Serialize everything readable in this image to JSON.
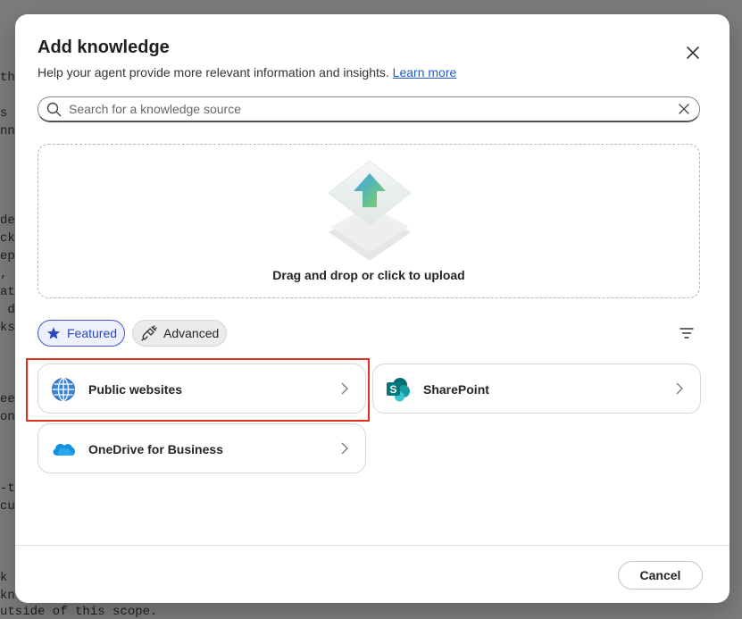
{
  "background_text": [
    {
      "id": "bg1",
      "text": "th"
    },
    {
      "id": "bg2",
      "text": "s"
    },
    {
      "id": "bg3",
      "text": "nn"
    },
    {
      "id": "bg4",
      "text": "de"
    },
    {
      "id": "bg5",
      "text": "ck"
    },
    {
      "id": "bg6",
      "text": "ep"
    },
    {
      "id": "bg7",
      "text": ","
    },
    {
      "id": "bg8",
      "text": "at"
    },
    {
      "id": "bg9",
      "text": " d"
    },
    {
      "id": "bg10",
      "text": "ks"
    },
    {
      "id": "bg11",
      "text": "ee"
    },
    {
      "id": "bg12",
      "text": "on"
    },
    {
      "id": "bg13",
      "text": "-t"
    },
    {
      "id": "bg14",
      "text": "cu"
    },
    {
      "id": "bg15",
      "text": "k"
    },
    {
      "id": "bg16",
      "text": "kn"
    },
    {
      "id": "bg17",
      "text": "utside of this scope."
    }
  ],
  "dialog": {
    "title": "Add knowledge",
    "subtitle": "Help your agent provide more relevant information and insights.",
    "learn_more": "Learn more",
    "close_icon": "close-icon"
  },
  "search": {
    "placeholder": "Search for a knowledge source",
    "value": ""
  },
  "dropzone": {
    "label": "Drag and drop or click to upload",
    "icon": "upload-icon"
  },
  "filters": {
    "featured": "Featured",
    "advanced": "Advanced",
    "active": "Featured"
  },
  "sources": [
    {
      "label": "Public websites",
      "icon": "globe-icon"
    },
    {
      "label": "SharePoint",
      "icon": "sharepoint-icon"
    },
    {
      "label": "OneDrive for Business",
      "icon": "onedrive-icon"
    }
  ],
  "footer": {
    "cancel": "Cancel"
  },
  "colors": {
    "accent": "#2b47c0",
    "link": "#1f5cc9",
    "highlight": "#e0301e"
  }
}
